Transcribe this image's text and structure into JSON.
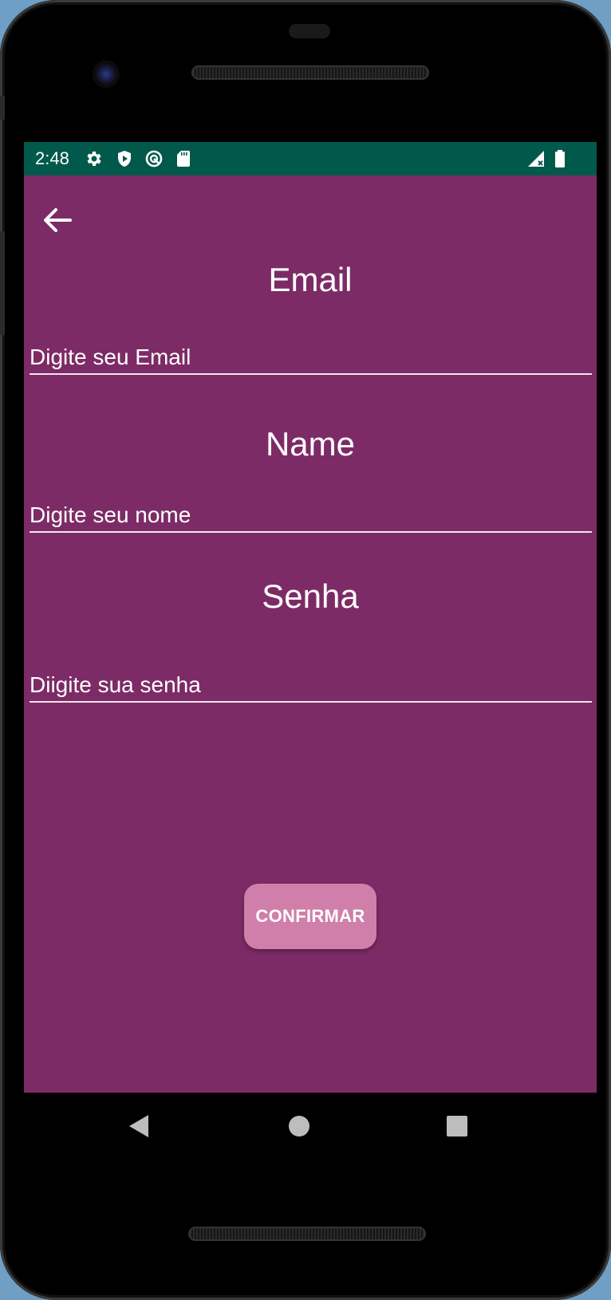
{
  "status_bar": {
    "time": "2:48",
    "icons": [
      "settings-icon",
      "play-protect-icon",
      "sync-icon",
      "sd-card-icon",
      "signal-icon",
      "battery-icon"
    ],
    "color": "#00594a"
  },
  "app": {
    "background_color": "#7d2b66",
    "back_icon": "arrow-back-icon",
    "sections": [
      {
        "title": "Email",
        "placeholder": "Digite seu Email",
        "value": ""
      },
      {
        "title": "Name",
        "placeholder": "Digite seu nome",
        "value": ""
      },
      {
        "title": "Senha",
        "placeholder": "Diigite sua senha",
        "value": ""
      }
    ],
    "confirm_label": "CONFIRMAR",
    "confirm_color": "#cf7fa9"
  },
  "nav_bar": {
    "icons": [
      "nav-back-icon",
      "nav-home-icon",
      "nav-recents-icon"
    ]
  }
}
